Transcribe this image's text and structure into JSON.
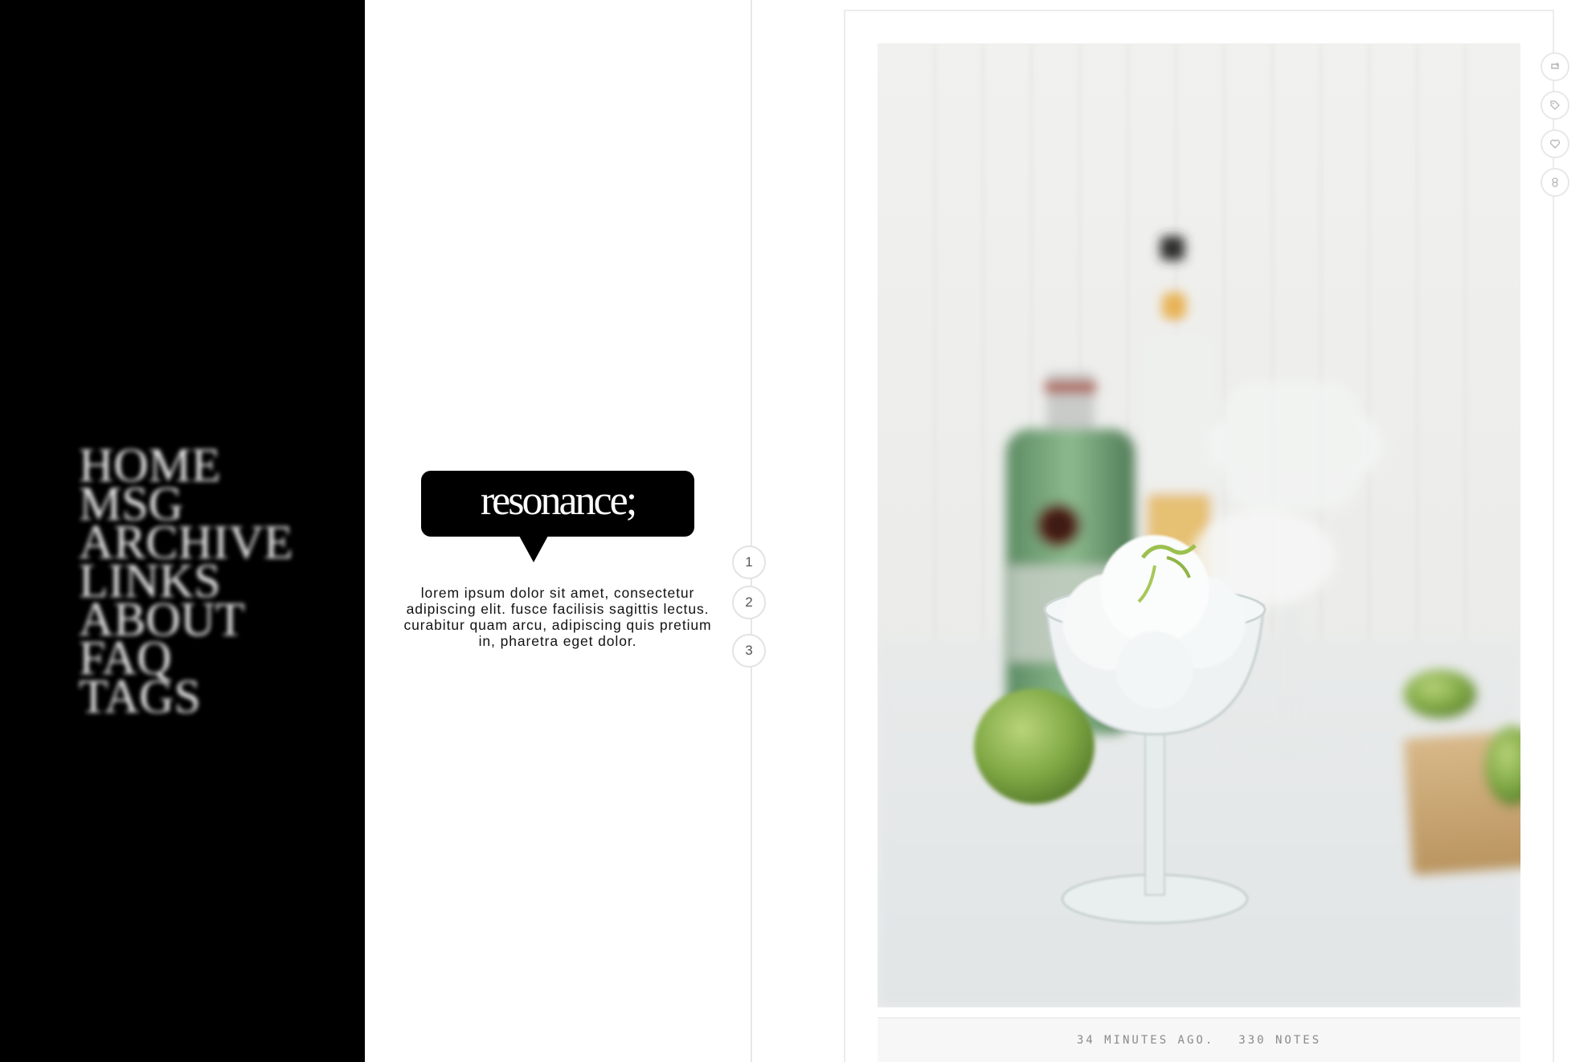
{
  "sidebar": {
    "nav_items": [
      {
        "label": "Home"
      },
      {
        "label": "Msg"
      },
      {
        "label": "Archive"
      },
      {
        "label": "Links"
      },
      {
        "label": "About"
      },
      {
        "label": "FAQ"
      },
      {
        "label": "Tags"
      }
    ]
  },
  "header": {
    "title": "resonance;",
    "description": "lorem ipsum dolor sit amet, consectetur adipiscing elit. fusce facilisis sagittis lectus. curabitur quam arcu, adipiscing quis pretium in, pharetra eget dolor."
  },
  "pagination": {
    "pages": [
      "1",
      "2",
      "3"
    ]
  },
  "post": {
    "image_alt": "sorbet in a coupe glass with limes and bottles",
    "time_ago": "34 minutes ago.",
    "notes": "330 notes"
  },
  "post_actions": [
    {
      "icon": "reblog-icon"
    },
    {
      "icon": "tag-icon"
    },
    {
      "icon": "heart-icon"
    },
    {
      "icon": "link-icon"
    }
  ],
  "colors": {
    "sidebar_bg": "#000000",
    "page_bg": "#ffffff",
    "meta_text": "#8a8a8a",
    "border": "#ececec"
  }
}
